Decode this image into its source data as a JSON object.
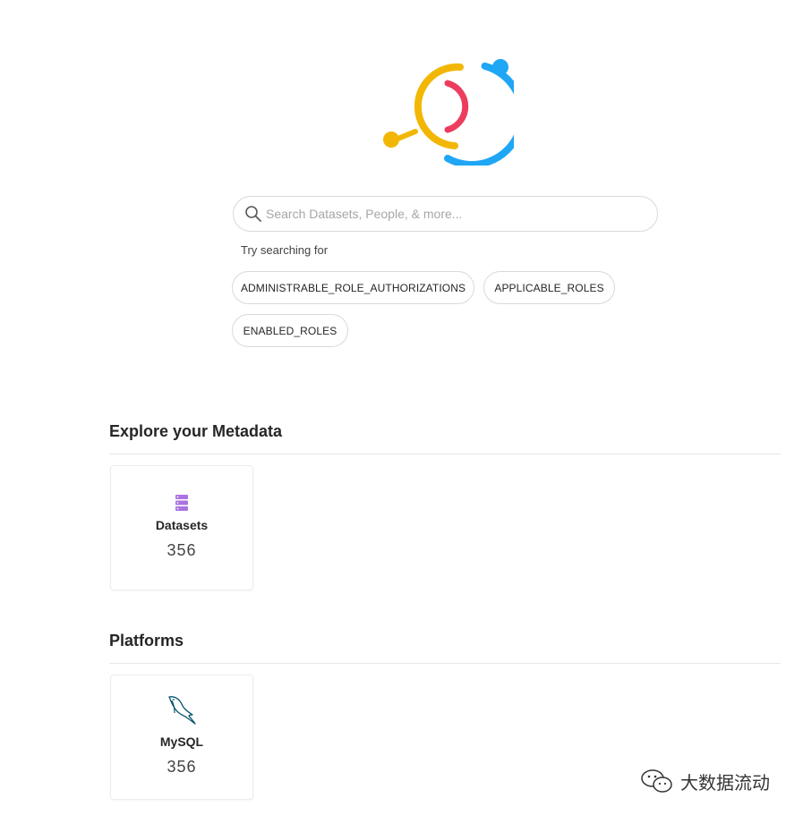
{
  "search": {
    "placeholder": "Search Datasets, People, & more...",
    "try_label": "Try searching for",
    "suggestions": [
      "ADMINISTRABLE_ROLE_AUTHORIZATIONS",
      "APPLICABLE_ROLES",
      "ENABLED_ROLES"
    ]
  },
  "explore": {
    "title": "Explore your Metadata",
    "cards": [
      {
        "name": "Datasets",
        "count": "356",
        "icon": "database-icon"
      }
    ]
  },
  "platforms": {
    "title": "Platforms",
    "cards": [
      {
        "name": "MySQL",
        "count": "356",
        "icon": "mysql-dolphin-icon"
      }
    ]
  },
  "watermark": {
    "text": "大数据流动"
  },
  "colors": {
    "logo_yellow": "#f2b705",
    "logo_blue": "#1fa6f5",
    "logo_red": "#ec3d5e",
    "dataset_icon": "#a974e0",
    "mysql_icon": "#00546b"
  }
}
